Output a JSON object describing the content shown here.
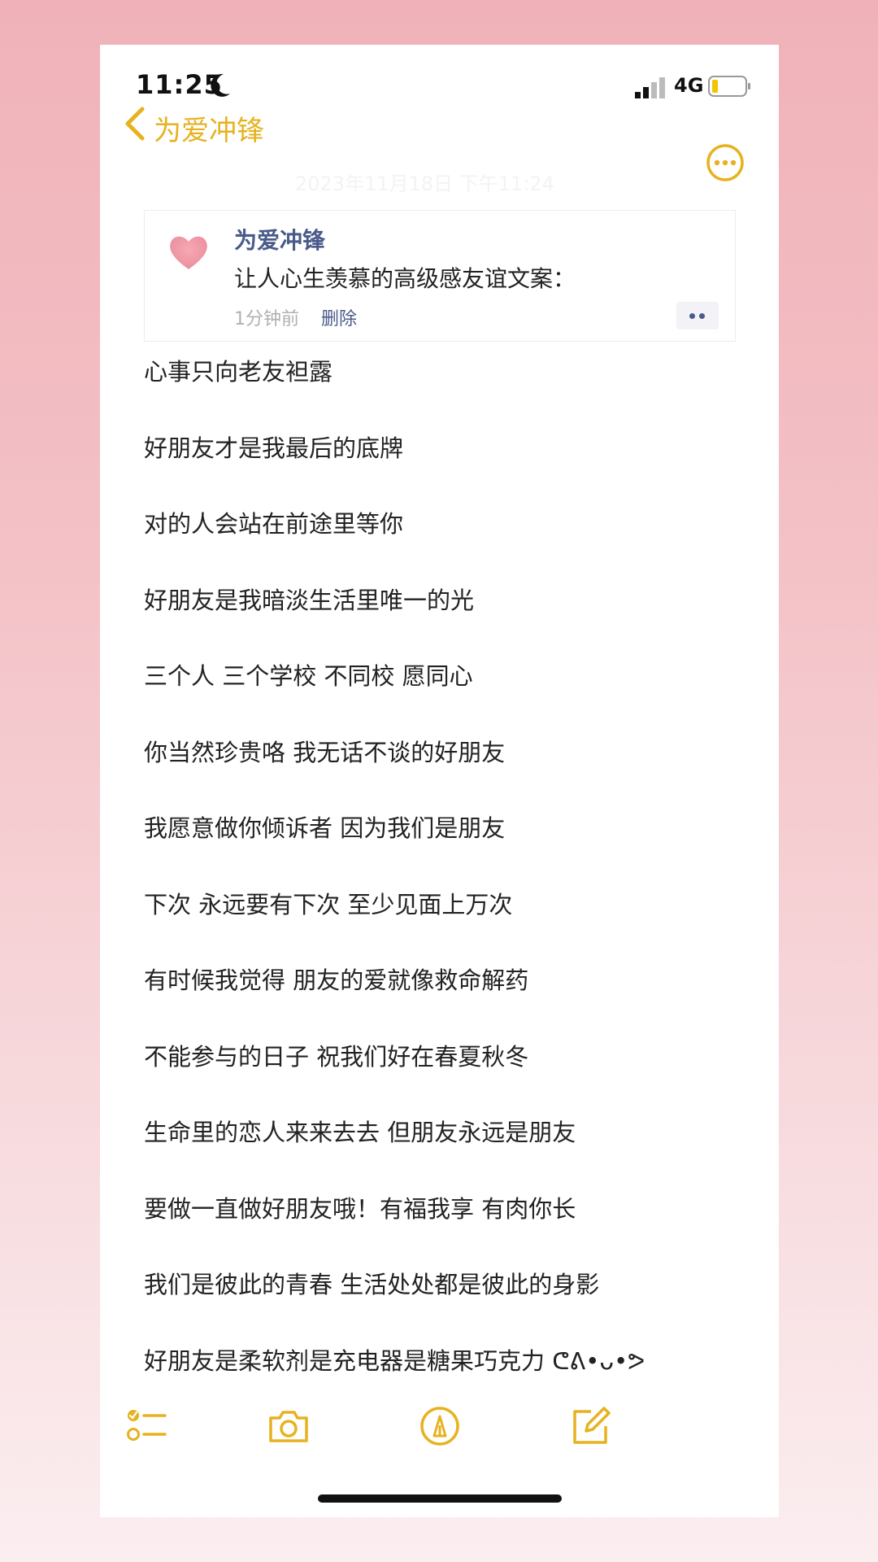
{
  "status_bar": {
    "time": "11:25",
    "network": "4G"
  },
  "nav": {
    "back_label": "为爱冲锋",
    "date_faint": "2023年11月18日 下午11:24"
  },
  "card": {
    "title": "为爱冲锋",
    "text": "让人心生羡慕的高级感友谊文案：",
    "time": "1分钟前",
    "delete_label": "删除"
  },
  "lines": [
    "心事只向老友袒露",
    "好朋友才是我最后的底牌",
    "对的人会站在前途里等你",
    "好朋友是我暗淡生活里唯一的光",
    "三个人 三个学校 不同校 愿同心",
    "你当然珍贵咯 我无话不谈的好朋友",
    "我愿意做你倾诉者 因为我们是朋友",
    "下次 永远要有下次 至少见面上万次",
    "有时候我觉得 朋友的爱就像救命解药",
    "不能参与的日子 祝我们好在春夏秋冬",
    "生命里的恋人来来去去 但朋友永远是朋友",
    "要做一直做好朋友哦！有福我享 有肉你长",
    "我们是彼此的青春 生活处处都是彼此的身影",
    "好朋友是柔软剂是充电器是糖果巧克力 ᕦᕕ•ᴗ•ᕗ"
  ],
  "icons": {
    "moon": "moon-icon",
    "signal": "signal-icon",
    "battery": "battery-icon",
    "back": "chevron-left-icon",
    "more": "ellipsis-circle-icon",
    "heart": "heart-icon",
    "checklist": "checklist-icon",
    "camera": "camera-icon",
    "markup": "markup-pen-icon",
    "compose": "compose-icon"
  },
  "colors": {
    "accent": "#e6b21f",
    "link": "#4a5b8a",
    "background_pink": "#f0b2b8"
  }
}
